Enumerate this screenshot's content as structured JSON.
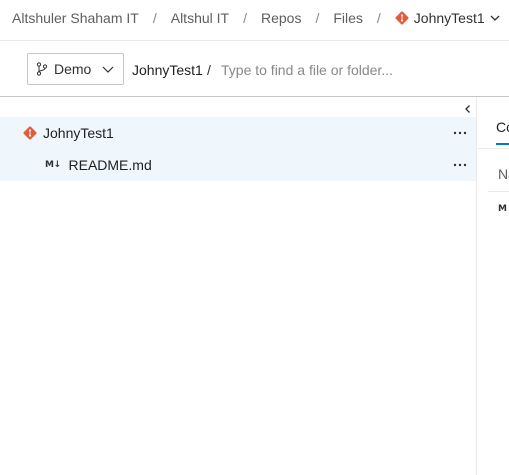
{
  "breadcrumb": {
    "org": "Altshuler Shaham IT",
    "project": "Altshul IT",
    "section": "Repos",
    "page": "Files",
    "repo": "JohnyTest1",
    "separator": "/"
  },
  "pathbar": {
    "branch": "Demo",
    "repo": "JohnyTest1",
    "separator": "/",
    "search_placeholder": "Type to find a file or folder..."
  },
  "tree": {
    "items": [
      {
        "label": "JohnyTest1",
        "icon": "git-repo-icon",
        "more": "more-icon"
      },
      {
        "label": "README.md",
        "icon": "markdown-icon",
        "icon_text": "M↓",
        "more": "more-icon"
      }
    ]
  },
  "right_pane": {
    "tab_label": "Co",
    "column_header": "Na",
    "file_icon_text": "M↓"
  },
  "colors": {
    "git_orange": "#e05d3b",
    "selection": "#eff6fc",
    "accent": "#0078d4"
  }
}
